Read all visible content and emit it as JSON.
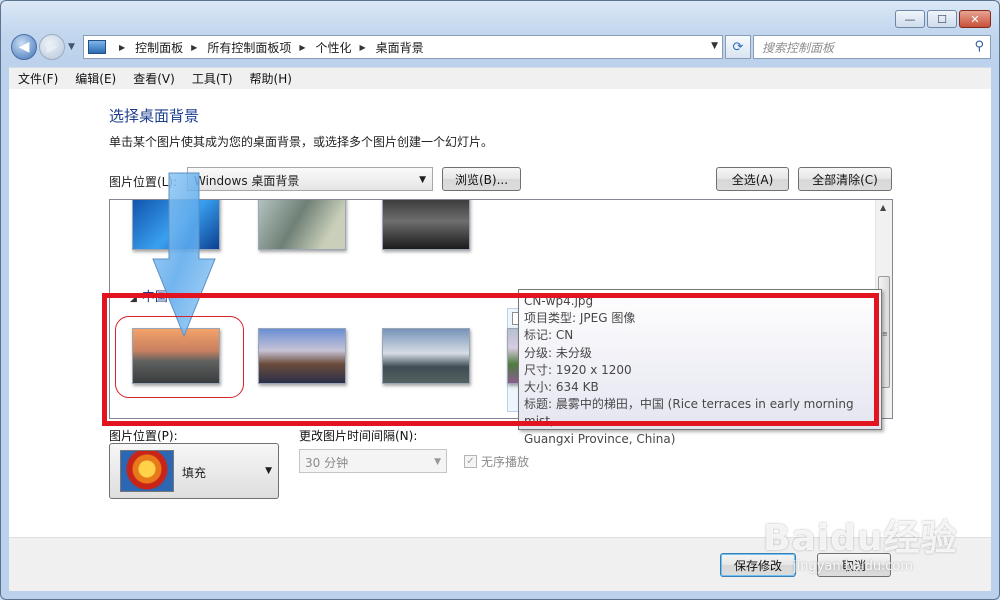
{
  "window": {
    "minimize_glyph": "—",
    "maximize_glyph": "☐",
    "close_glyph": "✕"
  },
  "nav": {
    "breadcrumbs": [
      "控制面板",
      "所有控制面板项",
      "个性化",
      "桌面背景"
    ],
    "search_placeholder": "搜索控制面板"
  },
  "menu": [
    "文件(F)",
    "编辑(E)",
    "查看(V)",
    "工具(T)",
    "帮助(H)"
  ],
  "page": {
    "title": "选择桌面背景",
    "description": "单击某个图片使其成为您的桌面背景，或选择多个图片创建一个幻灯片。",
    "location_label": "图片位置(L):",
    "location_value": "Windows 桌面背景",
    "browse_button": "浏览(B)...",
    "select_all_button": "全选(A)",
    "clear_all_button": "全部清除(C)"
  },
  "gallery": {
    "group_label": "中国",
    "top_row_icons": [
      "windows-blue-thumb",
      "woman-windswept-thumb",
      "silver-car-thumb"
    ],
    "china_thumbs": [
      "guilin-river-thumb",
      "great-wall-thumb",
      "misty-mountains-thumb",
      "rice-terraces-thumb",
      "coast-rocks-thumb",
      "seventeen-arch-bridge-thumb"
    ]
  },
  "options": {
    "position_label": "图片位置(P):",
    "position_value": "填充",
    "interval_label": "更改图片时间间隔(N):",
    "interval_value": "30 分钟",
    "shuffle_label": "无序播放"
  },
  "tooltip": {
    "lines": [
      "CN-wp4.jpg",
      "项目类型: JPEG 图像",
      "标记: CN",
      "分级: 未分级",
      "尺寸: 1920 x 1200",
      "大小: 634 KB",
      "标题: 晨雾中的梯田，中国 (Rice terraces in early morning mist,",
      "Guangxi Province, China)"
    ]
  },
  "footer": {
    "save_button": "保存修改",
    "cancel_button": "取消"
  },
  "watermark": {
    "brand": "Baidu经验",
    "url": "jingyan.baidu.com"
  }
}
